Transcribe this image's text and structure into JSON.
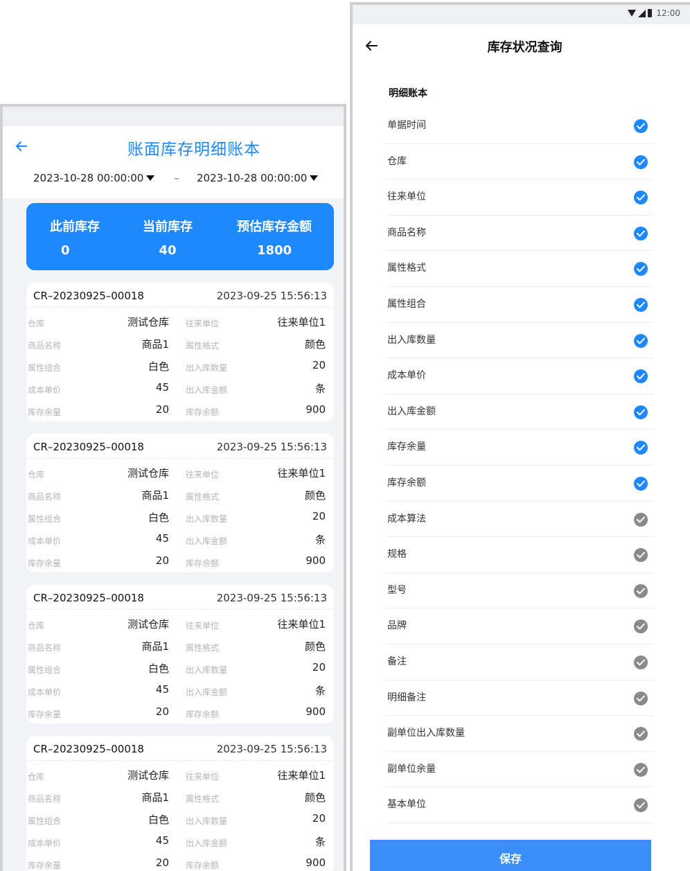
{
  "left": {
    "title": "账面库存明细账本",
    "date_start": "2023-10-28 00:00:00",
    "date_sep": "–",
    "date_end": "2023-10-28 00:00:00",
    "summary": [
      {
        "label": "此前库存",
        "value": "0"
      },
      {
        "label": "当前库存",
        "value": "40"
      },
      {
        "label": "预估库存金额",
        "value": "1800"
      }
    ],
    "labels": {
      "warehouse": "仓库",
      "partner": "往来单位",
      "product": "商品名称",
      "attr_format": "属性格式",
      "attr_combo": "属性组合",
      "io_qty": "出入库数量",
      "unit_cost": "成本单价",
      "io_amount": "出入库金额",
      "stock_qty": "库存余量",
      "stock_amount": "库存余额"
    },
    "records": [
      {
        "no": "CR–20230925–00018",
        "time": "2023-09-25 15:56:13",
        "warehouse": "测试仓库",
        "partner": "往来单位1",
        "product": "商品1",
        "attr_format": "颜色",
        "attr_combo": "白色",
        "io_qty": "20",
        "unit_cost": "45",
        "io_amount": "条",
        "stock_qty": "20",
        "stock_amount": "900"
      },
      {
        "no": "CR–20230925–00018",
        "time": "2023-09-25 15:56:13",
        "warehouse": "测试仓库",
        "partner": "往来单位1",
        "product": "商品1",
        "attr_format": "颜色",
        "attr_combo": "白色",
        "io_qty": "20",
        "unit_cost": "45",
        "io_amount": "条",
        "stock_qty": "20",
        "stock_amount": "900"
      },
      {
        "no": "CR–20230925–00018",
        "time": "2023-09-25 15:56:13",
        "warehouse": "测试仓库",
        "partner": "往来单位1",
        "product": "商品1",
        "attr_format": "颜色",
        "attr_combo": "白色",
        "io_qty": "20",
        "unit_cost": "45",
        "io_amount": "条",
        "stock_qty": "20",
        "stock_amount": "900"
      },
      {
        "no": "CR–20230925–00018",
        "time": "2023-09-25 15:56:13",
        "warehouse": "测试仓库",
        "partner": "往来单位1",
        "product": "商品1",
        "attr_format": "颜色",
        "attr_combo": "白色",
        "io_qty": "20",
        "unit_cost": "45",
        "io_amount": "条",
        "stock_qty": "20",
        "stock_amount": "900"
      }
    ]
  },
  "right": {
    "status_time": "12:00",
    "title": "库存状况查询",
    "section": "明细账本",
    "options": [
      {
        "label": "单据时间",
        "checked": true
      },
      {
        "label": "仓库",
        "checked": true
      },
      {
        "label": "往来单位",
        "checked": true
      },
      {
        "label": "商品名称",
        "checked": true
      },
      {
        "label": "属性格式",
        "checked": true
      },
      {
        "label": "属性组合",
        "checked": true
      },
      {
        "label": "出入库数量",
        "checked": true
      },
      {
        "label": "成本单价",
        "checked": true
      },
      {
        "label": "出入库金额",
        "checked": true
      },
      {
        "label": "库存余量",
        "checked": true
      },
      {
        "label": "库存余额",
        "checked": true
      },
      {
        "label": "成本算法",
        "checked": false
      },
      {
        "label": "规格",
        "checked": false
      },
      {
        "label": "型号",
        "checked": false
      },
      {
        "label": "品牌",
        "checked": false
      },
      {
        "label": "备注",
        "checked": false
      },
      {
        "label": "明细备注",
        "checked": false
      },
      {
        "label": "副单位出入库数量",
        "checked": false
      },
      {
        "label": "副单位余量",
        "checked": false
      },
      {
        "label": "基本单位",
        "checked": false
      }
    ],
    "save_label": "保存"
  },
  "colors": {
    "accent": "#1e88ff",
    "checked": "#1e88ff",
    "unchecked": "#8a8a8a",
    "page_bg": "#f2f3f6"
  }
}
